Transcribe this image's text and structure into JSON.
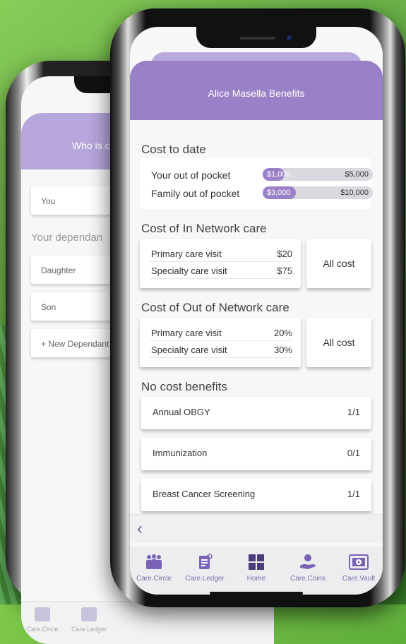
{
  "back_phone": {
    "header_title": "Who is c",
    "you_field": "You",
    "dependants_label": "Your dependan",
    "daughter": "Daughter",
    "son": "Son",
    "new_dependant": "+ New Dependant",
    "tabs": [
      "Care.Circle",
      "Care.Ledger"
    ]
  },
  "header": {
    "title": "Alice Masella Benefits"
  },
  "cost_to_date": {
    "title": "Cost to date",
    "rows": [
      {
        "label": "Your out of pocket",
        "value": "$1,000",
        "max": "$5,000",
        "fraction": 0.2
      },
      {
        "label": "Family out of pocket",
        "value": "$3,000",
        "max": "$10,000",
        "fraction": 0.3
      }
    ]
  },
  "in_network": {
    "title": "Cost of In Network care",
    "primary_label": "Primary care visit",
    "primary_value": "$20",
    "specialty_label": "Specialty care visit",
    "specialty_value": "$75",
    "all_cost": "All cost"
  },
  "out_network": {
    "title": "Cost of Out of Network care",
    "primary_label": "Primary care visit",
    "primary_value": "20%",
    "specialty_label": "Specialty care visit",
    "specialty_value": "30%",
    "all_cost": "All cost"
  },
  "no_cost": {
    "title": "No cost benefits",
    "items": [
      {
        "label": "Annual OBGY",
        "value": "1/1"
      },
      {
        "label": "Immunization",
        "value": "0/1"
      },
      {
        "label": "Breast Cancer Screening",
        "value": "1/1"
      }
    ]
  },
  "nav": {
    "back_arrow": "‹"
  },
  "tabbar": {
    "care_circle": "Care.Circle",
    "care_ledger": "Care.Ledger",
    "home": "Home",
    "care_coins": "Care.Coins",
    "care_vault": "Care.Vault"
  },
  "colors": {
    "accent": "#9a80c7",
    "bar_bg": "#d9d9e0",
    "background_green": "#5fae3c"
  }
}
